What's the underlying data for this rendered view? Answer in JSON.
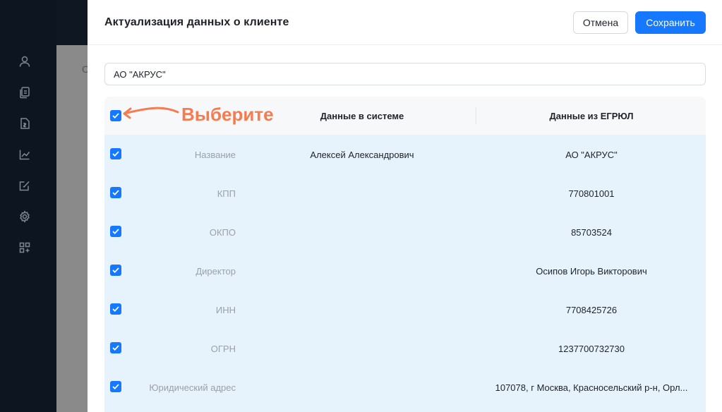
{
  "dialog": {
    "title": "Актуализация данных о клиенте",
    "cancel_label": "Отмена",
    "save_label": "Сохранить",
    "search_value": "АО \"АКРУС\""
  },
  "backdrop_letter": "С",
  "table": {
    "header": {
      "system": "Данные в системе",
      "egrul": "Данные из ЕГРЮЛ"
    },
    "annotation": "Выберите",
    "rows": [
      {
        "label": "Название",
        "system": "Алексей Александрович",
        "egrul": "АО \"АКРУС\"",
        "checked": true
      },
      {
        "label": "КПП",
        "system": "",
        "egrul": "770801001",
        "checked": true
      },
      {
        "label": "ОКПО",
        "system": "",
        "egrul": "85703524",
        "checked": true
      },
      {
        "label": "Директор",
        "system": "",
        "egrul": "Осипов Игорь Викторович",
        "checked": true
      },
      {
        "label": "ИНН",
        "system": "",
        "egrul": "7708425726",
        "checked": true
      },
      {
        "label": "ОГРН",
        "system": "",
        "egrul": "1237700732730",
        "checked": true
      },
      {
        "label": "Юридический адрес",
        "system": "",
        "egrul": "107078, г Москва, Красносельский р-н, Орл...",
        "checked": true
      }
    ]
  },
  "sidebar_icons": [
    "user-icon",
    "documents-icon",
    "invoice-icon",
    "chart-icon",
    "edit-task-icon",
    "settings-icon",
    "apps-icon"
  ],
  "colors": {
    "accent": "#1677ff",
    "row_bg": "#e6f3fc",
    "annotation": "#f47c50",
    "sidebar_bg": "#0d1520"
  }
}
